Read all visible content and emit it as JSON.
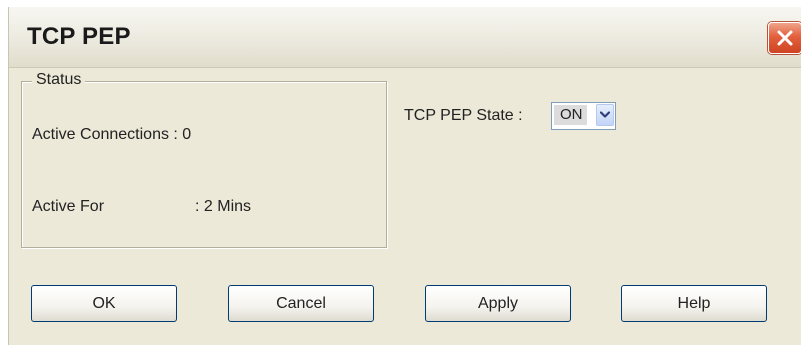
{
  "window": {
    "title": "TCP PEP"
  },
  "status": {
    "group_label": "Status",
    "active_connections_label": "Active Connections : 0",
    "active_for_label": "Active For",
    "active_for_value": ": 2 Mins"
  },
  "pep_state": {
    "label": "TCP PEP State :",
    "selected": "ON"
  },
  "buttons": {
    "ok": "OK",
    "cancel": "Cancel",
    "apply": "Apply",
    "help": "Help"
  },
  "colors": {
    "dialog_background": "#ece9d8",
    "close_button": "#e2603e",
    "button_border": "#003c74",
    "select_border": "#7f9db9"
  },
  "icons": {
    "close": "close-icon",
    "dropdown": "chevron-down-icon"
  }
}
